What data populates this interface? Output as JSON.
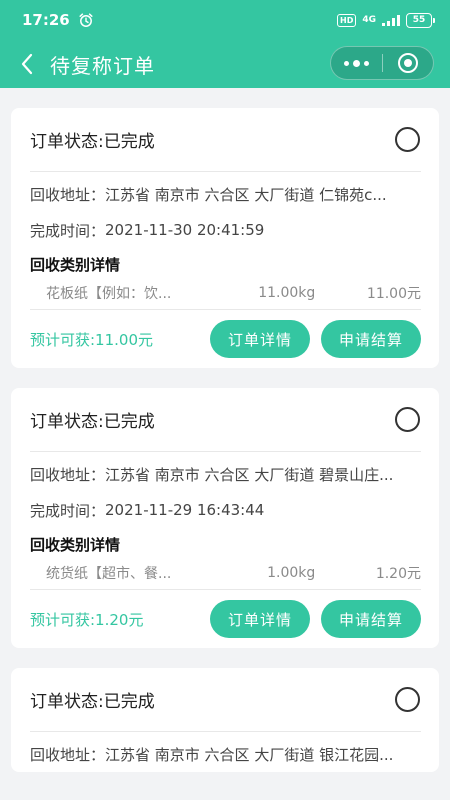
{
  "status_bar": {
    "time": "17:26",
    "hd": "HD",
    "network": "4G",
    "battery": "55"
  },
  "nav": {
    "title": "待复称订单"
  },
  "orders": [
    {
      "status": "订单状态:已完成",
      "address_label": "回收地址：",
      "address": "江苏省 南京市 六合区 大厂街道 仁锦苑c...",
      "time_label": "完成时间：",
      "time": "2021-11-30 20:41:59",
      "section_title": "回收类别详情",
      "item_name": "花板纸【例如：饮...",
      "item_weight": "11.00kg",
      "item_price": "11.00元",
      "estimate": "预计可获:11.00元",
      "detail_btn": "订单详情",
      "settle_btn": "申请结算"
    },
    {
      "status": "订单状态:已完成",
      "address_label": "回收地址：",
      "address": "江苏省 南京市 六合区 大厂街道 碧景山庄...",
      "time_label": "完成时间：",
      "time": "2021-11-29 16:43:44",
      "section_title": "回收类别详情",
      "item_name": "统货纸【超市、餐...",
      "item_weight": "1.00kg",
      "item_price": "1.20元",
      "estimate": "预计可获:1.20元",
      "detail_btn": "订单详情",
      "settle_btn": "申请结算"
    },
    {
      "status": "订单状态:已完成",
      "address_label": "回收地址：",
      "address": "江苏省 南京市 六合区 大厂街道 银江花园..."
    }
  ],
  "colors": {
    "accent": "#34c6a1",
    "background": "#f2f3f5"
  }
}
